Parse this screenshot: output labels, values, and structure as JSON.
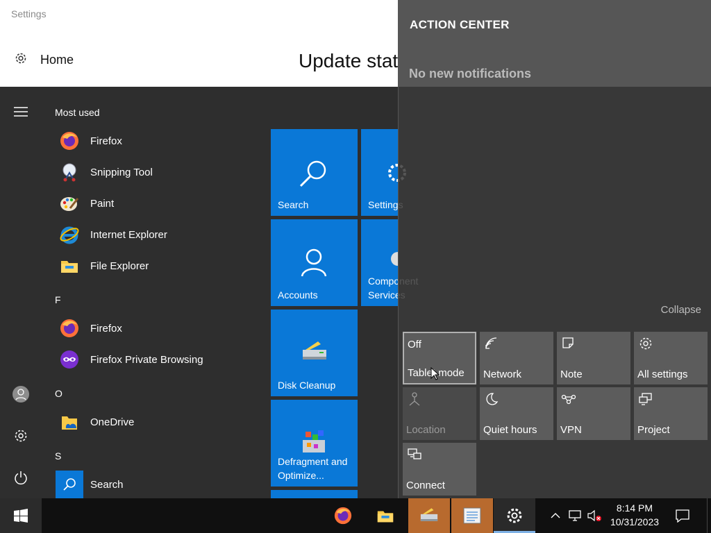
{
  "settings": {
    "window_title": "Settings",
    "home_label": "Home",
    "page_title": "Update stat"
  },
  "start_menu": {
    "most_used_header": "Most used",
    "most_used": [
      {
        "label": "Firefox",
        "icon": "firefox-icon"
      },
      {
        "label": "Snipping Tool",
        "icon": "snipping-tool-icon"
      },
      {
        "label": "Paint",
        "icon": "paint-icon"
      },
      {
        "label": "Internet Explorer",
        "icon": "internet-explorer-icon"
      },
      {
        "label": "File Explorer",
        "icon": "file-explorer-icon"
      }
    ],
    "groups": [
      {
        "letter": "F",
        "items": [
          {
            "label": "Firefox",
            "icon": "firefox-icon"
          },
          {
            "label": "Firefox Private Browsing",
            "icon": "firefox-private-icon"
          }
        ]
      },
      {
        "letter": "O",
        "items": [
          {
            "label": "OneDrive",
            "icon": "onedrive-icon"
          }
        ]
      },
      {
        "letter": "S",
        "items": [
          {
            "label": "Search",
            "icon": "search-icon"
          }
        ]
      }
    ],
    "tiles": [
      {
        "label": "Search",
        "icon": "search-icon"
      },
      {
        "label": "Settings",
        "icon": "gear-icon"
      },
      {
        "label": "Accounts",
        "icon": "person-icon"
      },
      {
        "label": "Component Services",
        "icon": "component-services-icon"
      },
      {
        "label": "Disk Cleanup",
        "icon": "disk-cleanup-icon"
      },
      {
        "label": "Defragment and Optimize...",
        "icon": "defragment-icon"
      }
    ],
    "tile_color": "#0a78d7"
  },
  "action_center": {
    "title": "ACTION CENTER",
    "empty_message": "No new notifications",
    "collapse_label": "Collapse",
    "quick_actions": [
      {
        "label": "Tablet mode",
        "state": "Off",
        "icon": "tablet-mode-icon"
      },
      {
        "label": "Network",
        "icon": "network-icon"
      },
      {
        "label": "Note",
        "icon": "note-icon"
      },
      {
        "label": "All settings",
        "icon": "gear-icon"
      },
      {
        "label": "Location",
        "icon": "location-icon"
      },
      {
        "label": "Quiet hours",
        "icon": "moon-icon"
      },
      {
        "label": "VPN",
        "icon": "vpn-icon"
      },
      {
        "label": "Project",
        "icon": "project-icon"
      },
      {
        "label": "Connect",
        "icon": "connect-icon"
      }
    ]
  },
  "taskbar": {
    "pinned": [
      "firefox-icon",
      "file-explorer-icon",
      "disk-cleanup-icon",
      "notepad-icon",
      "gear-icon"
    ],
    "clock": {
      "time": "8:14 PM",
      "date": "10/31/2023"
    }
  }
}
